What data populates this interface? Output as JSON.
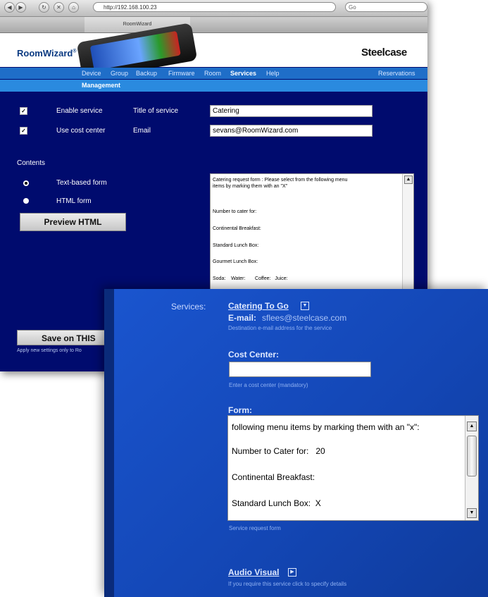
{
  "browser": {
    "url": "http://192.168.100.23",
    "tab_title": "RoomWizard",
    "search_placeholder": "Go"
  },
  "header": {
    "logo": "RoomWizard",
    "logo_mark": "®",
    "brand": "Steelcase"
  },
  "nav": {
    "items": [
      "Device",
      "Group",
      "Backup",
      "Firmware",
      "Room",
      "Services",
      "Help"
    ],
    "active": "Services",
    "reservations": "Reservations",
    "sub": "Management"
  },
  "settings": {
    "enable_service": "Enable service",
    "use_cost_center": "Use cost center",
    "title_label": "Title of service",
    "title_value": "Catering",
    "email_label": "Email",
    "email_value": "sevans@RoomWizard.com",
    "contents": "Contents",
    "text_form": "Text-based form",
    "html_form": "HTML form",
    "preview": "Preview HTML",
    "save": "Save on THIS",
    "apply_note": "Apply new settings only to Ro"
  },
  "form_text": {
    "line1": "Catering request form : Please select from the following menu",
    "line2": "items by marking them with an \"X\"",
    "line3": "Number to cater for:",
    "line4": "Continental Breakfast:",
    "line5": "Standard Lunch Box:",
    "line6": "Gourmet Lunch Box:",
    "line7": "Soda:    Water:       Coffee:   Juice:"
  },
  "front": {
    "services_label": "Services:",
    "service_name": "Catering To Go",
    "email_label": "E-mail:",
    "email_value": "sflees@steelcase.com",
    "email_hint": "Destination e-mail address for the service",
    "cost_center_label": "Cost Center:",
    "cost_center_value": "",
    "cost_center_hint": "Enter a cost center (mandatory)",
    "form_label": "Form:",
    "form_lines": [
      "following menu items by marking them with an \"x\":",
      "Number to Cater for:   20",
      "Continental Breakfast:",
      "Standard Lunch Box:  X"
    ],
    "form_hint": "Service request form",
    "audio_visual": "Audio Visual",
    "audio_hint": "If you require this service click to specify details"
  }
}
